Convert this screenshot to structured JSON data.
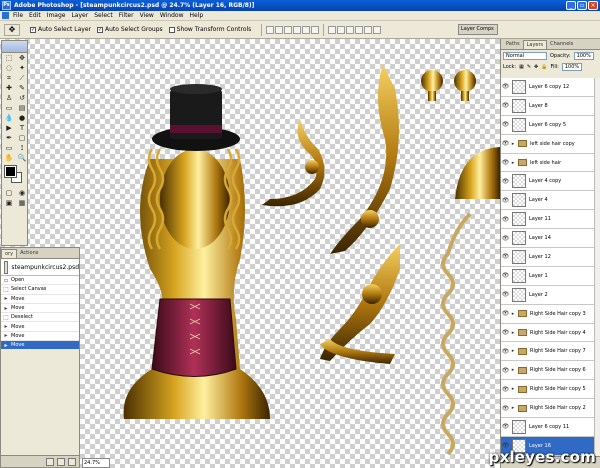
{
  "app": {
    "title": "Adobe Photoshop - [steampunkcircus2.psd @ 24.7% (Layer 16, RGB/8)]",
    "ps_icon": "Ps"
  },
  "window_controls": {
    "minimize": "_",
    "restore": "▫",
    "close": "×"
  },
  "menu": [
    "File",
    "Edit",
    "Image",
    "Layer",
    "Select",
    "Filter",
    "View",
    "Window",
    "Help"
  ],
  "options": {
    "auto_select_layer": "Auto Select Layer",
    "auto_select_groups": "Auto Select Groups",
    "show_transform_controls": "Show Transform Controls",
    "palette_well": "Layer Comps"
  },
  "history": {
    "tabs": [
      "ory",
      "Actions"
    ],
    "snapshot_label": "steampunkcircus2.psd",
    "items": [
      "Open",
      "Select Canvas",
      "Move",
      "Move",
      "Deselect",
      "Move",
      "Move",
      "Move"
    ],
    "selected_index": 7
  },
  "status": {
    "zoom": "24.7%"
  },
  "layers_panel": {
    "tabs": [
      "Paths",
      "Layers",
      "Channels"
    ],
    "active_tab": "Layers",
    "blend_mode": "Normal",
    "opacity_label": "Opacity:",
    "opacity": "100%",
    "lock_label": "Lock:",
    "fill_label": "Fill:",
    "fill": "100%",
    "layers": [
      {
        "name": "Layer 6 copy 12",
        "type": "layer"
      },
      {
        "name": "Layer 8",
        "type": "layer"
      },
      {
        "name": "Layer 6 copy 5",
        "type": "layer"
      },
      {
        "name": "left side hair copy",
        "type": "group"
      },
      {
        "name": "left side hair",
        "type": "group"
      },
      {
        "name": "Layer 4 copy",
        "type": "layer"
      },
      {
        "name": "Layer 4",
        "type": "layer"
      },
      {
        "name": "Layer 11",
        "type": "layer"
      },
      {
        "name": "Layer 14",
        "type": "layer"
      },
      {
        "name": "Layer 12",
        "type": "layer"
      },
      {
        "name": "Layer 1",
        "type": "layer"
      },
      {
        "name": "Layer 2",
        "type": "layer"
      },
      {
        "name": "Right Side Hair copy 3",
        "type": "group"
      },
      {
        "name": "Right Side Hair copy 4",
        "type": "group"
      },
      {
        "name": "Right Side Hair copy 7",
        "type": "group"
      },
      {
        "name": "Right Side Hair copy 6",
        "type": "group"
      },
      {
        "name": "Right Side Hair copy 5",
        "type": "group"
      },
      {
        "name": "Right Side Hair copy 2",
        "type": "group"
      },
      {
        "name": "Layer 6 copy 11",
        "type": "layer"
      },
      {
        "name": "Layer 16",
        "type": "layer",
        "selected": true
      }
    ]
  },
  "watermark": "pxleyes.com",
  "colors": {
    "title_blue": "#0842b0",
    "selection": "#316ac5",
    "gold": "#b8860b",
    "corset": "#8b1a3a"
  }
}
